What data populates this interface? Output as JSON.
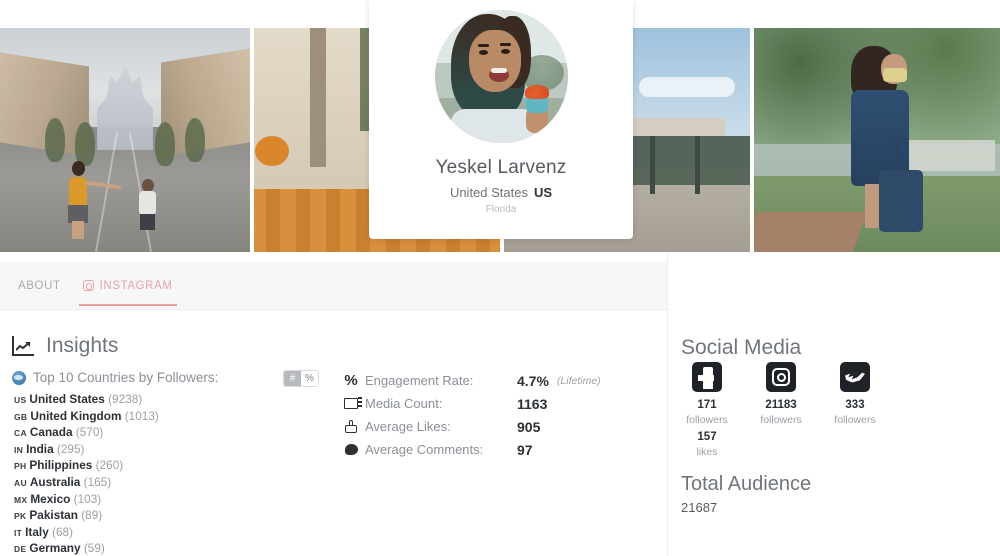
{
  "profile": {
    "name": "Yeskel Larvenz",
    "country": "United States",
    "country_code": "US",
    "region": "Florida"
  },
  "tabs": [
    {
      "label": "ABOUT",
      "active": false,
      "icon": null
    },
    {
      "label": "INSTAGRAM",
      "active": true,
      "icon": "instagram-icon"
    }
  ],
  "insights": {
    "title": "Insights",
    "icon": "chart-line-up-icon",
    "countries_label": "Top 10 Countries by Followers:",
    "countries_icon": "globe-icon",
    "toggle": {
      "active": "#",
      "inactive": "%"
    },
    "countries": [
      {
        "code": "US",
        "name": "United States",
        "count": "(9238)"
      },
      {
        "code": "GB",
        "name": "United Kingdom",
        "count": "(1013)"
      },
      {
        "code": "CA",
        "name": "Canada",
        "count": "(570)"
      },
      {
        "code": "IN",
        "name": "India",
        "count": "(295)"
      },
      {
        "code": "PH",
        "name": "Philippines",
        "count": "(260)"
      },
      {
        "code": "AU",
        "name": "Australia",
        "count": "(165)"
      },
      {
        "code": "MX",
        "name": "Mexico",
        "count": "(103)"
      },
      {
        "code": "PK",
        "name": "Pakistan",
        "count": "(89)"
      },
      {
        "code": "IT",
        "name": "Italy",
        "count": "(68)"
      },
      {
        "code": "DE",
        "name": "Germany",
        "count": "(59)"
      }
    ],
    "stats": [
      {
        "icon": "percent-icon",
        "label": "Engagement Rate:",
        "value": "4.7%",
        "note": "(Lifetime)"
      },
      {
        "icon": "media-icon",
        "label": "Media Count:",
        "value": "1163",
        "note": ""
      },
      {
        "icon": "thumbs-up-icon",
        "label": "Average Likes:",
        "value": "905",
        "note": ""
      },
      {
        "icon": "comment-icon",
        "label": "Average Comments:",
        "value": "97",
        "note": ""
      }
    ]
  },
  "social_media": {
    "title": "Social Media",
    "accounts": [
      {
        "icon": "facebook-icon",
        "value": "171",
        "unit": "followers"
      },
      {
        "icon": "instagram-icon",
        "value": "21183",
        "unit": "followers"
      },
      {
        "icon": "twitter-icon",
        "value": "333",
        "unit": "followers"
      }
    ],
    "extra": {
      "value": "157",
      "unit": "likes"
    }
  },
  "total_audience": {
    "title": "Total Audience",
    "value": "21687"
  },
  "colors": {
    "accent": "#e8a0a0",
    "tabbar_bg": "#f7f7f8",
    "text_muted": "#8b9097",
    "text_dark": "#2c3136"
  }
}
